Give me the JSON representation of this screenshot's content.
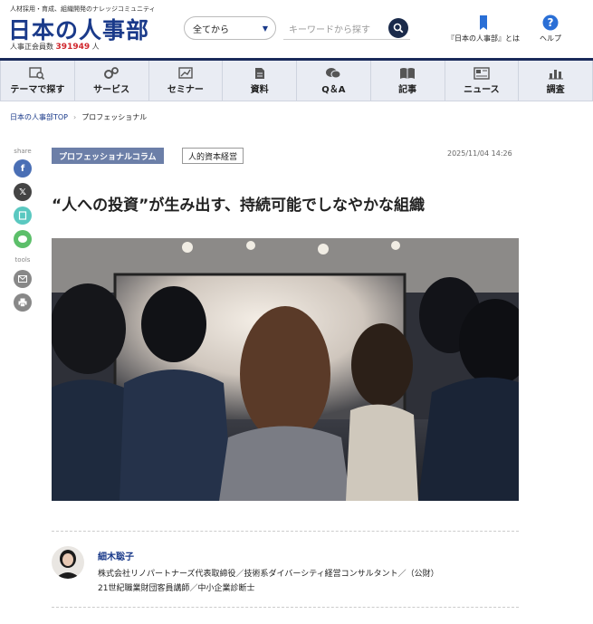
{
  "header": {
    "tagline": "人材採用・育成、組織開発のナレッジコミュニティ",
    "logo": "日本の人事部",
    "members_label": "人事正会員数",
    "members_count": "391949",
    "members_unit": "人",
    "select_value": "全てから",
    "search_placeholder": "キーワードから探す",
    "about_label": "『日本の人事部』とは",
    "help_label": "ヘルプ"
  },
  "nav": [
    {
      "label": "テーマで探す",
      "icon": "search-doc-icon"
    },
    {
      "label": "サービス",
      "icon": "gears-icon"
    },
    {
      "label": "セミナー",
      "icon": "chart-board-icon"
    },
    {
      "label": "資料",
      "icon": "document-icon"
    },
    {
      "label": "Q＆A",
      "icon": "chat-icon"
    },
    {
      "label": "記事",
      "icon": "book-icon"
    },
    {
      "label": "ニュース",
      "icon": "newspaper-icon"
    },
    {
      "label": "調査",
      "icon": "bar-chart-icon"
    }
  ],
  "breadcrumb": {
    "home": "日本の人事部TOP",
    "current": "プロフェッショナル"
  },
  "share": {
    "share_label": "share",
    "tools_label": "tools"
  },
  "article": {
    "category": "プロフェッショナルコラム",
    "tag": "人的資本経営",
    "date": "2025/11/04 14:26",
    "title": "“人への投資”が生み出す、持続可能でしなやかな組織"
  },
  "author": {
    "name": "細木聡子",
    "desc_line1": "株式会社リノパートナーズ代表取締役／技術系ダイバーシティ経営コンサルタント／（公財）",
    "desc_line2": "21世紀職業財団客員講師／中小企業診断士"
  },
  "colors": {
    "brand": "#1a3a8a",
    "count": "#d0262c",
    "tag": "#6c7fa8"
  }
}
